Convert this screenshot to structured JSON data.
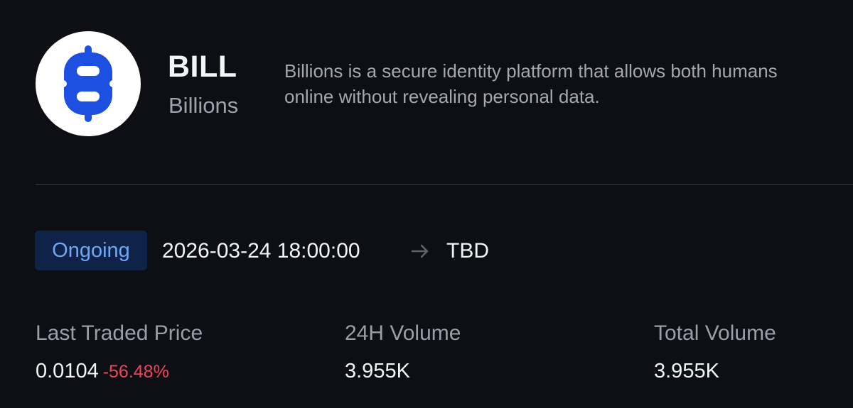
{
  "token": {
    "ticker": "BILL",
    "name": "Billions",
    "description_lines": [
      "Billions is a secure identity platform that allows both humans",
      "online without revealing personal data."
    ],
    "logo_icon": "billions-logo-icon"
  },
  "status": {
    "label": "Ongoing",
    "start": "2026-03-24 18:00:00",
    "arrow_icon": "arrow-right-icon",
    "end": "TBD"
  },
  "stats": {
    "last_traded_price": {
      "label": "Last Traded Price",
      "value": "0.0104",
      "change": "-56.48%"
    },
    "volume_24h": {
      "label": "24H Volume",
      "value": "3.955K"
    },
    "total_volume": {
      "label": "Total Volume",
      "value": "3.955K"
    }
  },
  "colors": {
    "background": "#0e0f14",
    "logo_blue": "#1d4fe0",
    "badge_bg": "#0f2349",
    "badge_text": "#6ea7f5",
    "negative": "#f0445a"
  }
}
